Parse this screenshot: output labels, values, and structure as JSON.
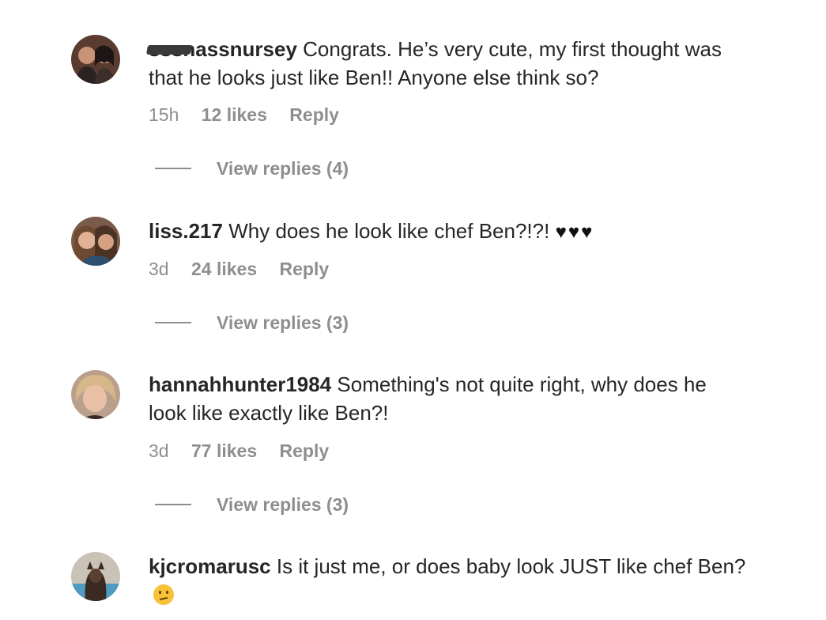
{
  "comments": [
    {
      "username_redacted": "s",
      "username_visible": "ssnursey",
      "text": "Congrats. He’s very cute, my first thought was that he looks just like Ben!! Anyone else think so?",
      "time": "15h",
      "likes": "12 likes",
      "reply": "Reply",
      "view_replies": "View replies (4)"
    },
    {
      "username": "liss.217",
      "text": "Why does he look like chef Ben?!?!",
      "emoji": "♥♥♥",
      "time": "3d",
      "likes": "24 likes",
      "reply": "Reply",
      "view_replies": "View replies (3)"
    },
    {
      "username": "hannahhunter1984",
      "text": "Something's not quite right, why does he look like exactly like Ben?!",
      "time": "3d",
      "likes": "77 likes",
      "reply": "Reply",
      "view_replies": "View replies (3)"
    },
    {
      "username": "kjcromarusc",
      "text": "Is it just me, or does baby look JUST like chef Ben?",
      "emoji_icon": "thinking-face-icon"
    }
  ]
}
